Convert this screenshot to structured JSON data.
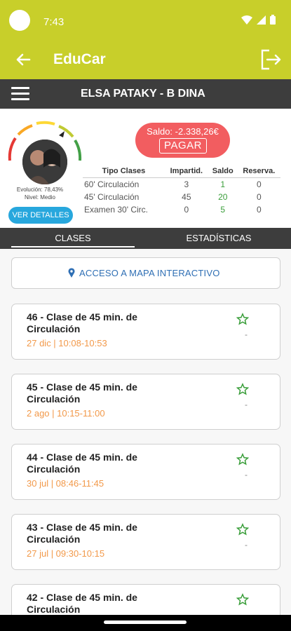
{
  "status": {
    "time": "7:43"
  },
  "app": {
    "title": "EduCar"
  },
  "student": {
    "name": "ELSA PATAKY - B DINA"
  },
  "summary": {
    "evolution_line1": "Evolución: 78,43%",
    "evolution_line2": "Nivel: Medio",
    "details_label": "VER DETALLES",
    "saldo_text": "Saldo: -2.338,26€",
    "pay_label": "PAGAR",
    "gauge_level": 0.78
  },
  "stats": {
    "headers": [
      "Tipo Clases",
      "Impartid.",
      "Saldo",
      "Reserva."
    ],
    "rows": [
      [
        "60' Circulación",
        "3",
        "1",
        "0"
      ],
      [
        "45' Circulación",
        "45",
        "20",
        "0"
      ],
      [
        "Examen 30' Circ.",
        "0",
        "5",
        "0"
      ]
    ]
  },
  "tabs": {
    "clases": "CLASES",
    "estadisticas": "ESTADÍSTICAS"
  },
  "map": {
    "label": "ACCESO A MAPA INTERACTIVO"
  },
  "classes": [
    {
      "title": "46 - Clase de 45 min. de Circulación",
      "date": "27 dic | 10:08-10:53",
      "rating": "-"
    },
    {
      "title": "45 - Clase de 45 min. de Circulación",
      "date": "2 ago | 10:15-11:00",
      "rating": "-"
    },
    {
      "title": "44 - Clase de 45 min. de Circulación",
      "date": "30 jul | 08:46-11:45",
      "rating": "-"
    },
    {
      "title": "43 - Clase de 45 min. de Circulación",
      "date": "27 jul | 09:30-10:15",
      "rating": "-"
    },
    {
      "title": "42 - Clase de 45 min. de Circulación",
      "date": "",
      "rating": ""
    }
  ],
  "colors": {
    "brand": "#c8cf2a",
    "dark": "#3d3d3d",
    "saldo": "#f25d60",
    "accent": "#27a7dd",
    "date": "#f2994a"
  },
  "icons": [
    "back-arrow-icon",
    "logout-icon",
    "hamburger-menu-icon",
    "map-pin-icon",
    "star-outline-icon",
    "wifi-icon",
    "signal-icon",
    "battery-icon"
  ]
}
